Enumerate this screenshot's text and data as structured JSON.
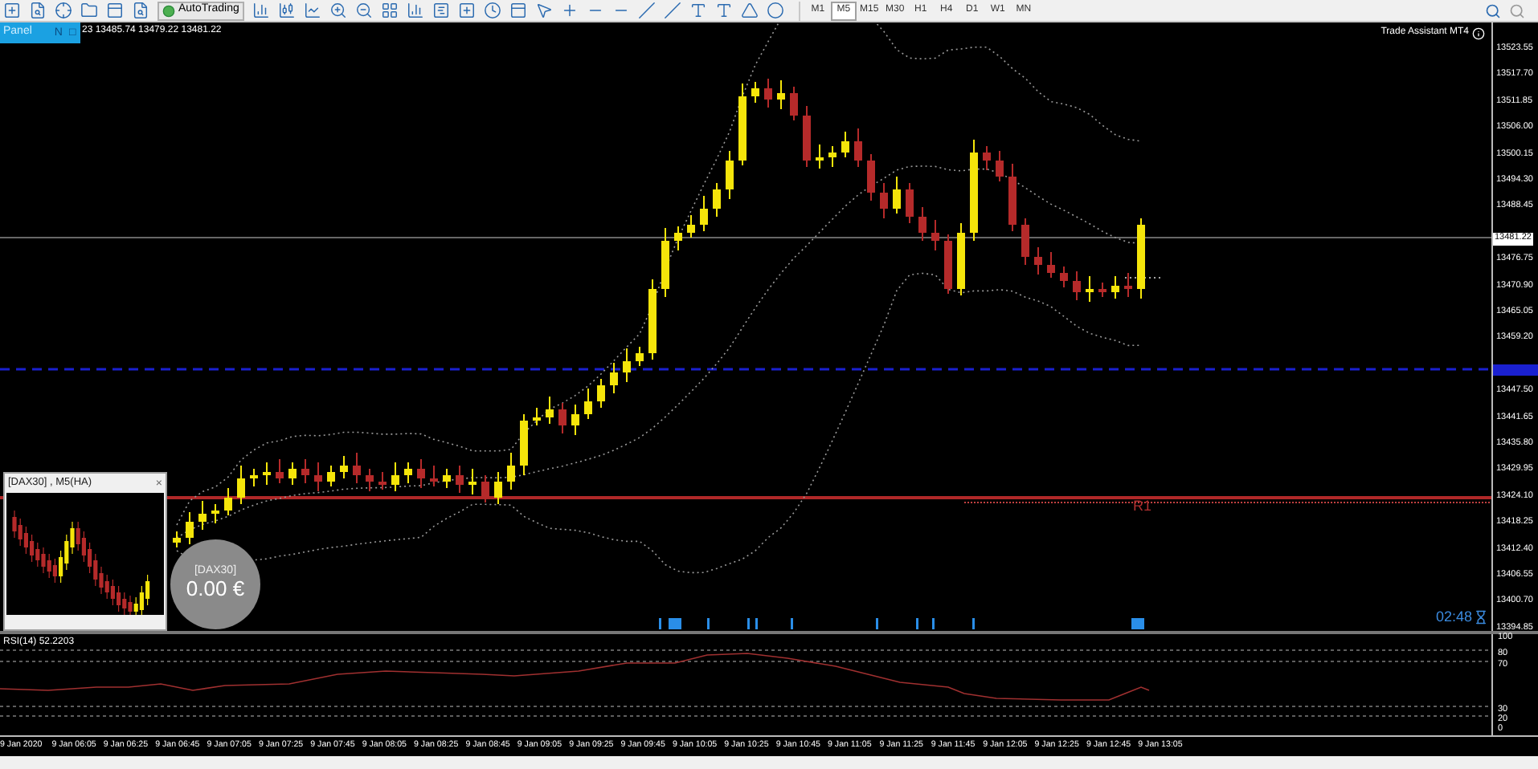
{
  "toolbar": {
    "autotrading": "AutoTrading",
    "timeframes": [
      {
        "label": "M1",
        "selected": false
      },
      {
        "label": "M5",
        "selected": true
      },
      {
        "label": "M15",
        "selected": false
      },
      {
        "label": "M30",
        "selected": false
      },
      {
        "label": "H1",
        "selected": false
      },
      {
        "label": "H4",
        "selected": false
      },
      {
        "label": "D1",
        "selected": false
      },
      {
        "label": "W1",
        "selected": false
      },
      {
        "label": "MN",
        "selected": false
      }
    ]
  },
  "panel_tab": {
    "label": "Panel",
    "buttons": [
      "N",
      "□"
    ]
  },
  "ohlc_text": "23 13485.74 13479.22 13481.22",
  "indicator_title": "Trade Assistant MT4",
  "price_axis": {
    "labels": [
      "13523.55",
      "13517.70",
      "13511.85",
      "13506.00",
      "13500.15",
      "13494.30",
      "13488.45",
      "13476.75",
      "13470.90",
      "13465.05",
      "13459.20",
      "13447.50",
      "13441.65",
      "13435.80",
      "13429.95",
      "13424.10",
      "13418.25",
      "13412.40",
      "13406.55",
      "13400.70",
      "13394.85"
    ],
    "current_price": "13481.22"
  },
  "pivot_label": "R1",
  "mini_chart": {
    "title": "[DAX30] , M5(HA)",
    "close": "×"
  },
  "profit_badge": {
    "symbol": "[DAX30]",
    "value": "0.00 €"
  },
  "countdown": "02:48",
  "rsi": {
    "title": "RSI(14) 52.2203",
    "levels": [
      "100",
      "80",
      "70",
      "30",
      "20",
      "0"
    ]
  },
  "time_axis": {
    "labels": [
      "9 Jan 2020",
      "9 Jan 06:05",
      "9 Jan 06:25",
      "9 Jan 06:45",
      "9 Jan 07:05",
      "9 Jan 07:25",
      "9 Jan 07:45",
      "9 Jan 08:05",
      "9 Jan 08:25",
      "9 Jan 08:45",
      "9 Jan 09:05",
      "9 Jan 09:25",
      "9 Jan 09:45",
      "9 Jan 10:05",
      "9 Jan 10:25",
      "9 Jan 10:45",
      "9 Jan 11:05",
      "9 Jan 11:25",
      "9 Jan 11:45",
      "9 Jan 12:05",
      "9 Jan 12:25",
      "9 Jan 12:45",
      "9 Jan 13:05"
    ]
  }
}
